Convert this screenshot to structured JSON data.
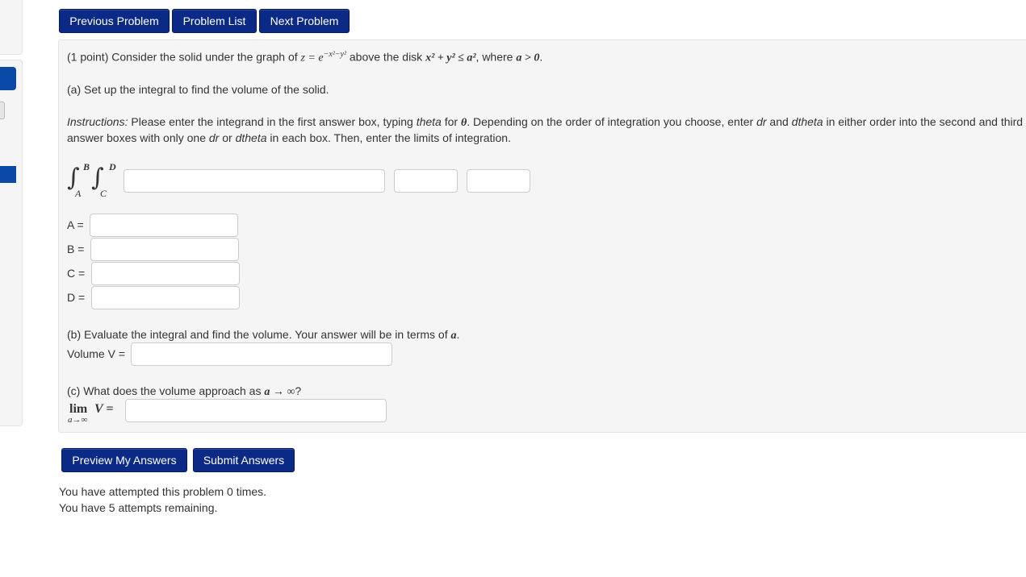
{
  "nav": {
    "previous": "Previous Problem",
    "list": "Problem List",
    "next": "Next Problem"
  },
  "problem": {
    "intro_pre": "(1 point) Consider the solid under the graph of",
    "intro_z": "z = e",
    "intro_exp": "−x²−y²",
    "intro_mid": "above the disk",
    "intro_disk": "x² + y² ≤ a²",
    "intro_where": ", where",
    "intro_cond": "a > 0",
    "intro_end": ".",
    "part_a": "(a) Set up the integral to find the volume of the solid.",
    "instr_label": "Instructions:",
    "instr_1": "Please enter the integrand in the first answer box, typing",
    "instr_theta": "theta",
    "instr_2": "for",
    "instr_theta_sym": "θ",
    "instr_3": ". Depending on the order of integration you choose, enter",
    "instr_dr": "dr",
    "instr_4": "and",
    "instr_dtheta": "dtheta",
    "instr_5": "in either order into the second and third",
    "instr_line2_pre": "answer boxes with only one",
    "instr_line2_dr": "dr",
    "instr_line2_or": "or",
    "instr_line2_dtheta": "dtheta",
    "instr_line2_post": "in each box. Then, enter the limits of integration.",
    "int_upper_1": "B",
    "int_lower_1": "A",
    "int_upper_2": "D",
    "int_lower_2": "C",
    "limit_A": "A =",
    "limit_B": "B =",
    "limit_C": "C =",
    "limit_D": "D =",
    "part_b_pre": "(b) Evaluate the integral and find the volume. Your answer will be in terms of",
    "part_b_var": "a",
    "part_b_end": ".",
    "volume_label": "Volume V =",
    "part_c_pre": "(c) What does the volume approach as",
    "part_c_expr": "a → ∞",
    "part_c_end": "?",
    "lim_word": "lim",
    "lim_sub": "a→∞",
    "lim_rhs": "V ="
  },
  "actions": {
    "preview": "Preview My Answers",
    "submit": "Submit Answers"
  },
  "status": {
    "attempted": "You have attempted this problem 0 times.",
    "remaining": "You have 5 attempts remaining."
  },
  "colors": {
    "button": "#0a2a86",
    "sidebar_accent": "#0a4aa6",
    "panel_bg": "#f5f5f5"
  }
}
